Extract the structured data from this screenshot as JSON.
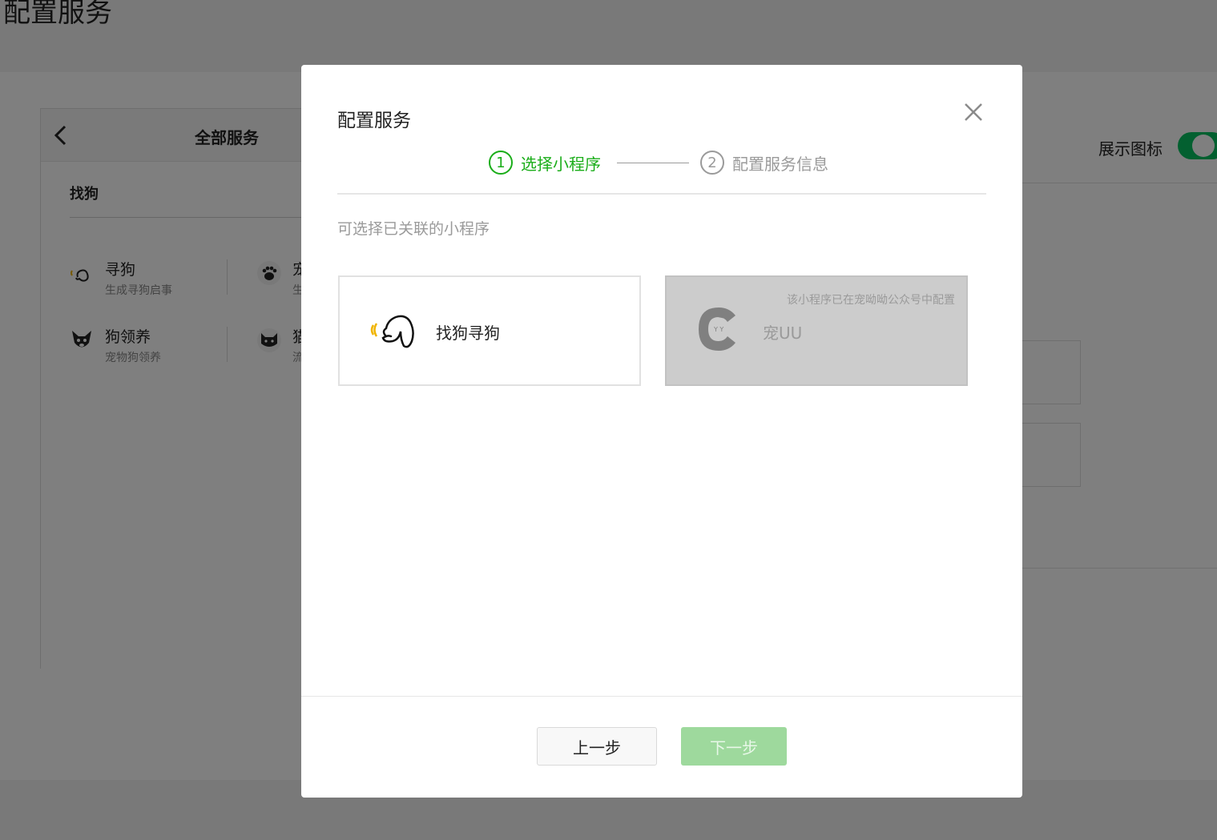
{
  "page": {
    "title": "配置服务",
    "show_icon_label": "展示图标"
  },
  "service_panel": {
    "header_title": "全部服务",
    "tab": "找狗",
    "items": [
      {
        "name": "寻狗",
        "desc": "生成寻狗启事",
        "icon": "dog-search-icon"
      },
      {
        "name": "宠",
        "desc": "生",
        "icon": "paw-icon"
      },
      {
        "name": "狗领养",
        "desc": "宠物狗领养",
        "icon": "dog-face-icon"
      },
      {
        "name": "猫",
        "desc": "流",
        "icon": "cat-face-icon"
      }
    ]
  },
  "dialog": {
    "title": "配置服务",
    "steps": [
      {
        "num": "1",
        "label": "选择小程序",
        "active": true
      },
      {
        "num": "2",
        "label": "配置服务信息",
        "active": false
      }
    ],
    "hint": "可选择已关联的小程序",
    "cards": [
      {
        "name": "找狗寻狗",
        "icon": "dog-search-icon",
        "disabled": false,
        "note": ""
      },
      {
        "name": "宠UU",
        "icon": "cat-logo-icon",
        "disabled": true,
        "note": "该小程序已在宠呦呦公众号中配置"
      }
    ],
    "prev_label": "上一步",
    "next_label": "下一步"
  },
  "colors": {
    "accent": "#1aad19",
    "toggle_on": "#07c160",
    "next_disabled": "#9ed99d"
  }
}
